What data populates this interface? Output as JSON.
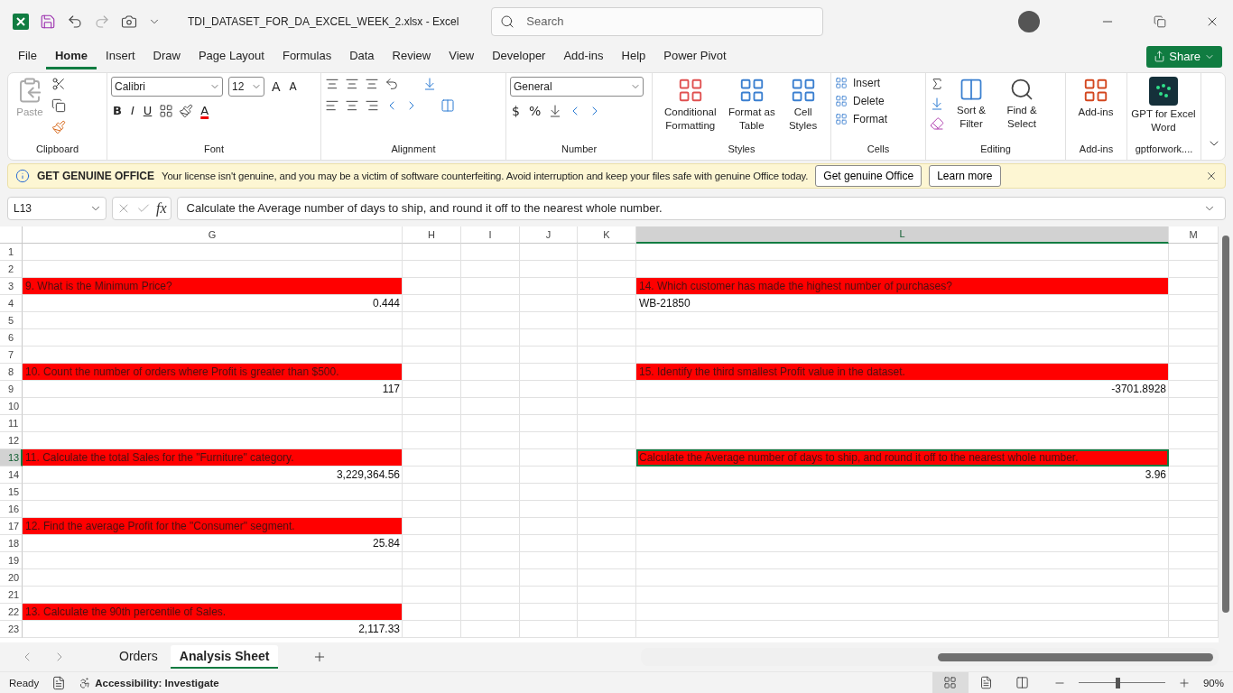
{
  "title_bar": {
    "title": "TDI_DATASET_FOR_DA_EXCEL_WEEK_2.xlsx  -  Excel",
    "search": {
      "placeholder": "Search"
    }
  },
  "menu": {
    "tabs": [
      {
        "label": "File",
        "selected": false
      },
      {
        "label": "Home",
        "selected": true
      },
      {
        "label": "Insert",
        "selected": false
      },
      {
        "label": "Draw",
        "selected": false
      },
      {
        "label": "Page Layout",
        "selected": false
      },
      {
        "label": "Formulas",
        "selected": false
      },
      {
        "label": "Data",
        "selected": false
      },
      {
        "label": "Review",
        "selected": false
      },
      {
        "label": "View",
        "selected": false
      },
      {
        "label": "Developer",
        "selected": false
      },
      {
        "label": "Add-ins",
        "selected": false
      },
      {
        "label": "Help",
        "selected": false
      },
      {
        "label": "Power Pivot",
        "selected": false
      }
    ],
    "share": "Share"
  },
  "ribbon": {
    "groups": [
      {
        "kind": "clipboard",
        "label": "Clipboard",
        "paste": "Paste"
      },
      {
        "kind": "font",
        "label": "Font",
        "font_name": "Calibri",
        "font_size": "12",
        "grow": "A",
        "shrink": "A",
        "bold": "B",
        "italic": "I",
        "underline": "U",
        "font_color": "A"
      },
      {
        "kind": "alignment",
        "label": "Alignment"
      },
      {
        "kind": "number",
        "label": "Number",
        "format": "General",
        "currency": "$",
        "percent": "%"
      },
      {
        "kind": "styles",
        "label": "Styles",
        "buttons": [
          "Conditional Formatting",
          "Format as Table",
          "Cell Styles"
        ]
      },
      {
        "kind": "cells",
        "label": "Cells",
        "buttons": [
          "Insert",
          "Delete",
          "Format"
        ]
      },
      {
        "kind": "editing",
        "label": "Editing",
        "buttons": [
          "Sort & Filter",
          "Find & Select"
        ]
      },
      {
        "kind": "addins",
        "label": "Add-ins",
        "buttons": [
          "Add-ins"
        ]
      },
      {
        "kind": "gpt",
        "label": "gptforwork....",
        "buttons": [
          "GPT for Excel Word"
        ]
      }
    ]
  },
  "banner": {
    "title": "GET GENUINE OFFICE",
    "message": "Your license isn't genuine, and you may be a victim of software counterfeiting. Avoid interruption and keep your files safe with genuine Office today.",
    "buttons": [
      "Get genuine Office",
      "Learn more"
    ]
  },
  "formula_bar": {
    "name_box": "L13",
    "fx": "fx",
    "formula": "Calculate the Average number of days to ship, and round it off to the nearest whole number."
  },
  "columns": [
    {
      "label": "G",
      "selected": false
    },
    {
      "label": "H",
      "selected": false
    },
    {
      "label": "I",
      "selected": false
    },
    {
      "label": "J",
      "selected": false
    },
    {
      "label": "K",
      "selected": false
    },
    {
      "label": "L",
      "selected": true
    },
    {
      "label": "M",
      "selected": false
    }
  ],
  "rows": [
    {
      "header": "1",
      "selected": false
    },
    {
      "header": "2",
      "selected": false
    },
    {
      "header": "3",
      "selected": false,
      "g": {
        "kind": "question",
        "text": "9. What is the Minimum Price?"
      },
      "l": {
        "kind": "question",
        "text": "14. Which customer has made the highest number of purchases?"
      }
    },
    {
      "header": "4",
      "selected": false,
      "g": {
        "kind": "number",
        "text": "0.444"
      },
      "l": {
        "kind": "text",
        "text": "WB-21850"
      }
    },
    {
      "header": "5",
      "selected": false
    },
    {
      "header": "6",
      "selected": false
    },
    {
      "header": "7",
      "selected": false
    },
    {
      "header": "8",
      "selected": false,
      "g": {
        "kind": "question",
        "text": "10. Count the number of orders where Profit is greater than $500."
      },
      "l": {
        "kind": "question",
        "text": "15. Identify the third smallest Profit value in the dataset."
      }
    },
    {
      "header": "9",
      "selected": false,
      "g": {
        "kind": "number",
        "text": "117"
      },
      "l": {
        "kind": "number",
        "text": "-3701.8928"
      }
    },
    {
      "header": "10",
      "selected": false
    },
    {
      "header": "11",
      "selected": false
    },
    {
      "header": "12",
      "selected": false
    },
    {
      "header": "13",
      "selected": true,
      "g": {
        "kind": "question",
        "text": "11. Calculate the total Sales for the \"Furniture\" category."
      },
      "l": {
        "kind": "question",
        "text": "Calculate the Average number of days to ship, and round it off to the nearest whole number.",
        "selected": true
      }
    },
    {
      "header": "14",
      "selected": false,
      "g": {
        "kind": "number",
        "text": "3,229,364.56"
      },
      "l": {
        "kind": "number",
        "text": "3.96"
      }
    },
    {
      "header": "15",
      "selected": false
    },
    {
      "header": "16",
      "selected": false
    },
    {
      "header": "17",
      "selected": false,
      "g": {
        "kind": "question",
        "text": "12. Find the average Profit for the \"Consumer\" segment."
      }
    },
    {
      "header": "18",
      "selected": false,
      "g": {
        "kind": "number",
        "text": "25.84"
      }
    },
    {
      "header": "19",
      "selected": false
    },
    {
      "header": "20",
      "selected": false
    },
    {
      "header": "21",
      "selected": false
    },
    {
      "header": "22",
      "selected": false,
      "g": {
        "kind": "question",
        "text": "13. Calculate the 90th percentile of Sales."
      }
    },
    {
      "header": "23",
      "selected": false,
      "g": {
        "kind": "number",
        "text": "2,117.33"
      }
    }
  ],
  "sheet_tabs": [
    {
      "label": "Orders",
      "selected": false
    },
    {
      "label": "Analysis Sheet",
      "selected": true
    }
  ],
  "status_bar": {
    "ready": "Ready",
    "accessibility": "Accessibility: Investigate",
    "view_buttons": [
      {
        "kind": "normal",
        "selected": true
      },
      {
        "kind": "page_layout",
        "selected": false
      },
      {
        "kind": "page_break",
        "selected": false
      }
    ],
    "zoom": {
      "level": 0.45,
      "reading": "90%"
    }
  }
}
